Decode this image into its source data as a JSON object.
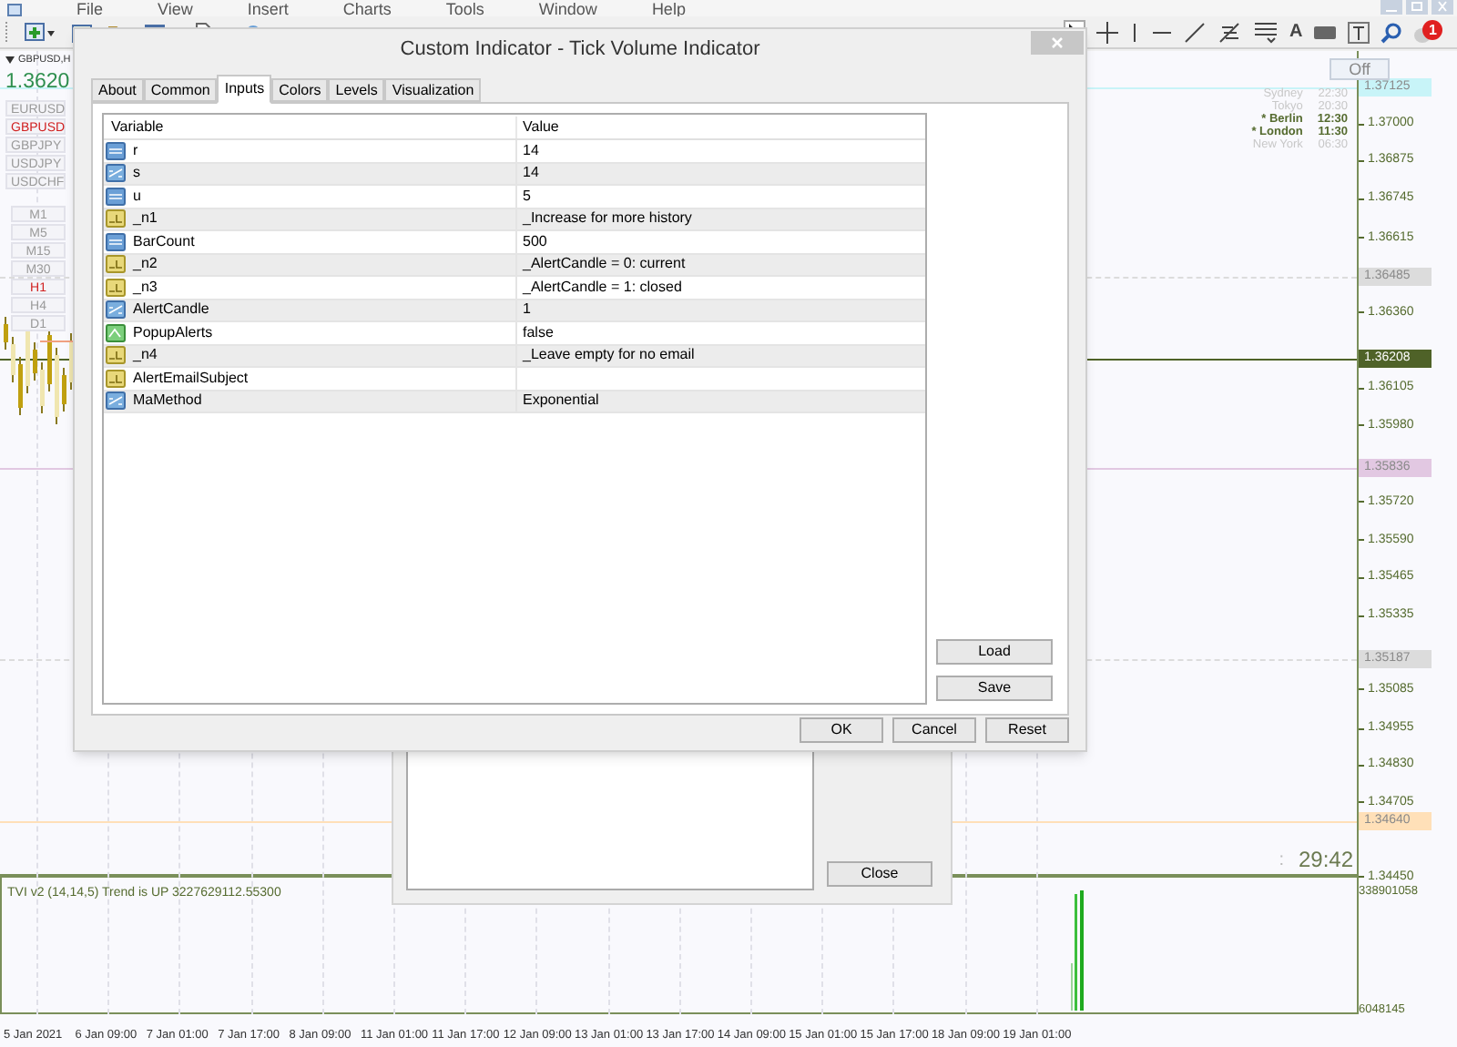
{
  "menu": [
    "File",
    "View",
    "Insert",
    "Charts",
    "Tools",
    "Window",
    "Help"
  ],
  "toolbar": {
    "text_tool": "A",
    "notification_count": "1"
  },
  "market_panel": {
    "symbol": "GBPUSD,H",
    "price": "1.3620",
    "symbols": [
      {
        "label": "EURUSD",
        "selected": false
      },
      {
        "label": "GBPUSD",
        "selected": true
      },
      {
        "label": "GBPJPY",
        "selected": false
      },
      {
        "label": "USDJPY",
        "selected": false
      },
      {
        "label": "USDCHF",
        "selected": false
      }
    ],
    "timeframes": [
      {
        "label": "M1",
        "selected": false
      },
      {
        "label": "M5",
        "selected": false
      },
      {
        "label": "M15",
        "selected": false
      },
      {
        "label": "M30",
        "selected": false
      },
      {
        "label": "H1",
        "selected": true
      },
      {
        "label": "H4",
        "selected": false
      },
      {
        "label": "D1",
        "selected": false
      }
    ]
  },
  "chart": {
    "clock_button": "Off",
    "clocks": [
      {
        "city": "Sydney",
        "time": "22:30",
        "highlighted": false
      },
      {
        "city": "Tokyo",
        "time": "20:30",
        "highlighted": false
      },
      {
        "city": "* Berlin",
        "time": "12:30",
        "highlighted": true
      },
      {
        "city": "* London",
        "time": "11:30",
        "highlighted": true
      },
      {
        "city": "New York",
        "time": "06:30",
        "highlighted": false
      }
    ],
    "countdown_separator": ":",
    "countdown": "29:42",
    "price_ticks": [
      "1.37000",
      "1.36875",
      "1.36745",
      "1.36615",
      "1.36360",
      "1.36105",
      "1.35980",
      "1.35720",
      "1.35590",
      "1.35465",
      "1.35335",
      "1.35085",
      "1.34955",
      "1.34830",
      "1.34705",
      "1.34450"
    ],
    "price_markers": [
      {
        "label": "1.37125",
        "color": "#c8f4f8"
      },
      {
        "label": "1.36485",
        "color": "#dcdcdc"
      },
      {
        "label": "1.36208",
        "color": "#4f6228"
      },
      {
        "label": "1.35836",
        "color": "#e2c8e2"
      },
      {
        "label": "1.35187",
        "color": "#dcdcdc"
      },
      {
        "label": "1.34640",
        "color": "#ffe0b8"
      }
    ],
    "indicator_label": "TVI v2 (14,14,5) Trend is UP 3227629112.55300",
    "indicator_axis": [
      "338901058",
      "6048145"
    ],
    "time_axis": [
      "5 Jan 2021",
      "6 Jan 09:00",
      "7 Jan 01:00",
      "7 Jan 17:00",
      "8 Jan 09:00",
      "11 Jan 01:00",
      "11 Jan 17:00",
      "12 Jan 09:00",
      "13 Jan 01:00",
      "13 Jan 17:00",
      "14 Jan 09:00",
      "15 Jan 01:00",
      "15 Jan 17:00",
      "18 Jan 09:00",
      "19 Jan 01:00"
    ]
  },
  "dialog": {
    "title": "Custom Indicator - Tick Volume Indicator",
    "tabs": [
      {
        "label": "About",
        "selected": false
      },
      {
        "label": "Common",
        "selected": false
      },
      {
        "label": "Inputs",
        "selected": true
      },
      {
        "label": "Colors",
        "selected": false
      },
      {
        "label": "Levels",
        "selected": false
      },
      {
        "label": "Visualization",
        "selected": false
      }
    ],
    "columns": [
      "Variable",
      "Value"
    ],
    "rows": [
      {
        "kind": "integer",
        "variable": "r",
        "value": "14"
      },
      {
        "kind": "enum",
        "variable": "s",
        "value": "14"
      },
      {
        "kind": "integer",
        "variable": "u",
        "value": "5"
      },
      {
        "kind": "text",
        "variable": "_n1",
        "value": "_Increase for more history"
      },
      {
        "kind": "integer",
        "variable": "BarCount",
        "value": "500"
      },
      {
        "kind": "text",
        "variable": "_n2",
        "value": "_AlertCandle = 0: current"
      },
      {
        "kind": "text",
        "variable": "_n3",
        "value": "_AlertCandle = 1: closed"
      },
      {
        "kind": "enum",
        "variable": "AlertCandle",
        "value": "1"
      },
      {
        "kind": "boolean",
        "variable": "PopupAlerts",
        "value": "false"
      },
      {
        "kind": "text",
        "variable": "_n4",
        "value": "_Leave empty for no email"
      },
      {
        "kind": "text",
        "variable": "AlertEmailSubject"
      },
      {
        "kind": "enum",
        "variable": "MaMethod",
        "value": "Exponential"
      }
    ],
    "side_buttons": [
      "Load",
      "Save"
    ],
    "buttons": [
      "OK",
      "Cancel",
      "Reset"
    ]
  },
  "back_dialog": {
    "button": "Close"
  }
}
